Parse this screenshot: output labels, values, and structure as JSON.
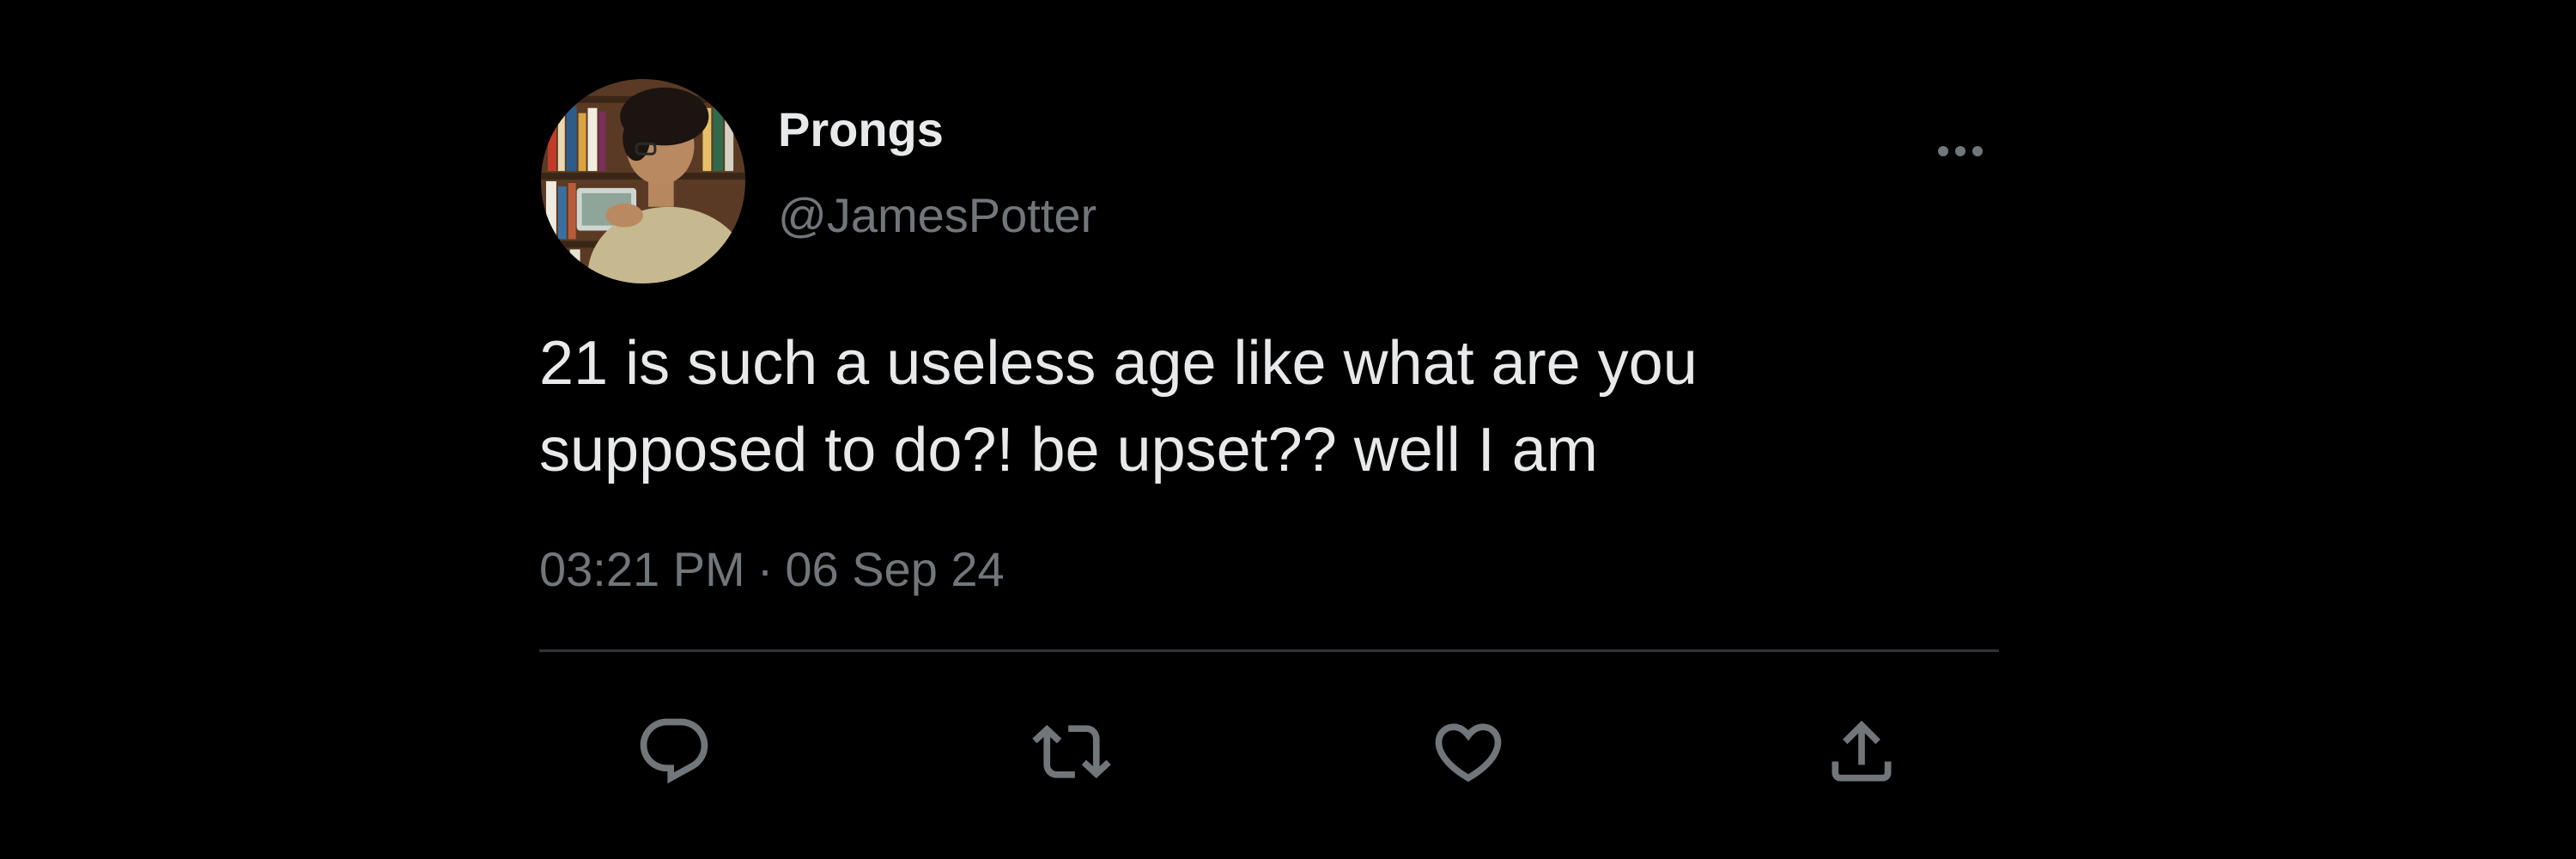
{
  "colors": {
    "background": "#000000",
    "primary_text": "#e7e9ea",
    "secondary_text": "#71767b",
    "divider": "#2f3336"
  },
  "tweet": {
    "author": {
      "display_name": "Prongs",
      "handle": "@JamesPotter",
      "avatar_icon": "profile-photo-avatar"
    },
    "text_lines": [
      "21 is such a useless age like what are you",
      "supposed to do?! be upset?? well I am"
    ],
    "time": "03:21 PM",
    "separator": "·",
    "date": "06 Sep 24",
    "more_icon": "more-options-icon"
  },
  "actions": [
    {
      "name": "reply",
      "icon": "reply-icon"
    },
    {
      "name": "retweet",
      "icon": "retweet-icon"
    },
    {
      "name": "like",
      "icon": "heart-icon"
    },
    {
      "name": "share",
      "icon": "share-icon"
    }
  ]
}
